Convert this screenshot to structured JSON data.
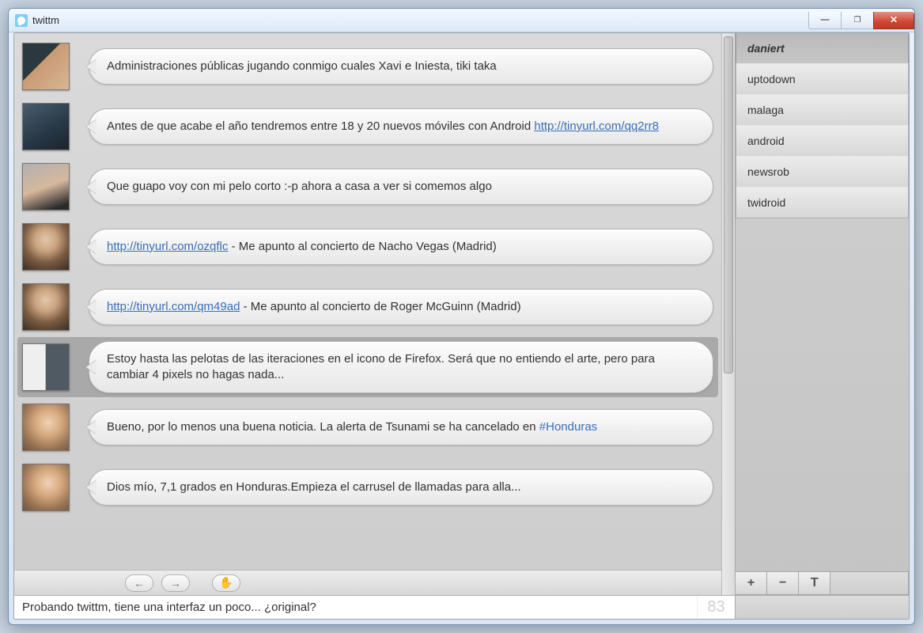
{
  "app": {
    "title": "twittm"
  },
  "timeline": {
    "entries": [
      {
        "avatar": "av1",
        "selected": false,
        "segments": [
          {
            "text": "Administraciones públicas jugando conmigo cuales Xavi e Iniesta, tiki taka"
          }
        ]
      },
      {
        "avatar": "av2",
        "selected": false,
        "segments": [
          {
            "text": "Antes de que acabe el año tendremos entre 18 y 20 nuevos móviles con Android "
          },
          {
            "link": "http://tinyurl.com/qq2rr8"
          }
        ]
      },
      {
        "avatar": "av3",
        "selected": false,
        "segments": [
          {
            "text": "Que guapo voy con mi pelo corto :-p ahora a casa a ver si comemos algo"
          }
        ]
      },
      {
        "avatar": "av4",
        "selected": false,
        "segments": [
          {
            "link": "http://tinyurl.com/ozqflc"
          },
          {
            "text": " - Me apunto al concierto de Nacho Vegas (Madrid)"
          }
        ]
      },
      {
        "avatar": "av4",
        "selected": false,
        "segments": [
          {
            "link": "http://tinyurl.com/qm49ad"
          },
          {
            "text": " - Me apunto al concierto de Roger McGuinn (Madrid)"
          }
        ]
      },
      {
        "avatar": "av5",
        "selected": true,
        "segments": [
          {
            "text": "Estoy hasta las pelotas de las iteraciones en el icono de Firefox. Será que no entiendo el arte, pero para cambiar 4 pixels no hagas nada..."
          }
        ]
      },
      {
        "avatar": "av6",
        "selected": false,
        "segments": [
          {
            "text": "Bueno, por lo menos una buena noticia. La alerta de Tsunami se ha cancelado en "
          },
          {
            "hashtag": "#Honduras"
          }
        ]
      },
      {
        "avatar": "av6",
        "selected": false,
        "segments": [
          {
            "text": "Dios mío, 7,1 grados en Honduras.Empieza el carrusel de llamadas para alla..."
          }
        ]
      }
    ],
    "nav": {
      "back": "←",
      "forward": "→",
      "stop": "✋"
    }
  },
  "sidebar": {
    "items": [
      {
        "label": "daniert",
        "active": true
      },
      {
        "label": "uptodown",
        "active": false
      },
      {
        "label": "malaga",
        "active": false
      },
      {
        "label": "android",
        "active": false
      },
      {
        "label": "newsrob",
        "active": false
      },
      {
        "label": "twidroid",
        "active": false
      }
    ],
    "tools": {
      "add": "+",
      "remove": "−",
      "text": "T"
    }
  },
  "compose": {
    "value": "Probando twittm, tiene una interfaz un poco... ¿original?",
    "char_count": "83"
  }
}
